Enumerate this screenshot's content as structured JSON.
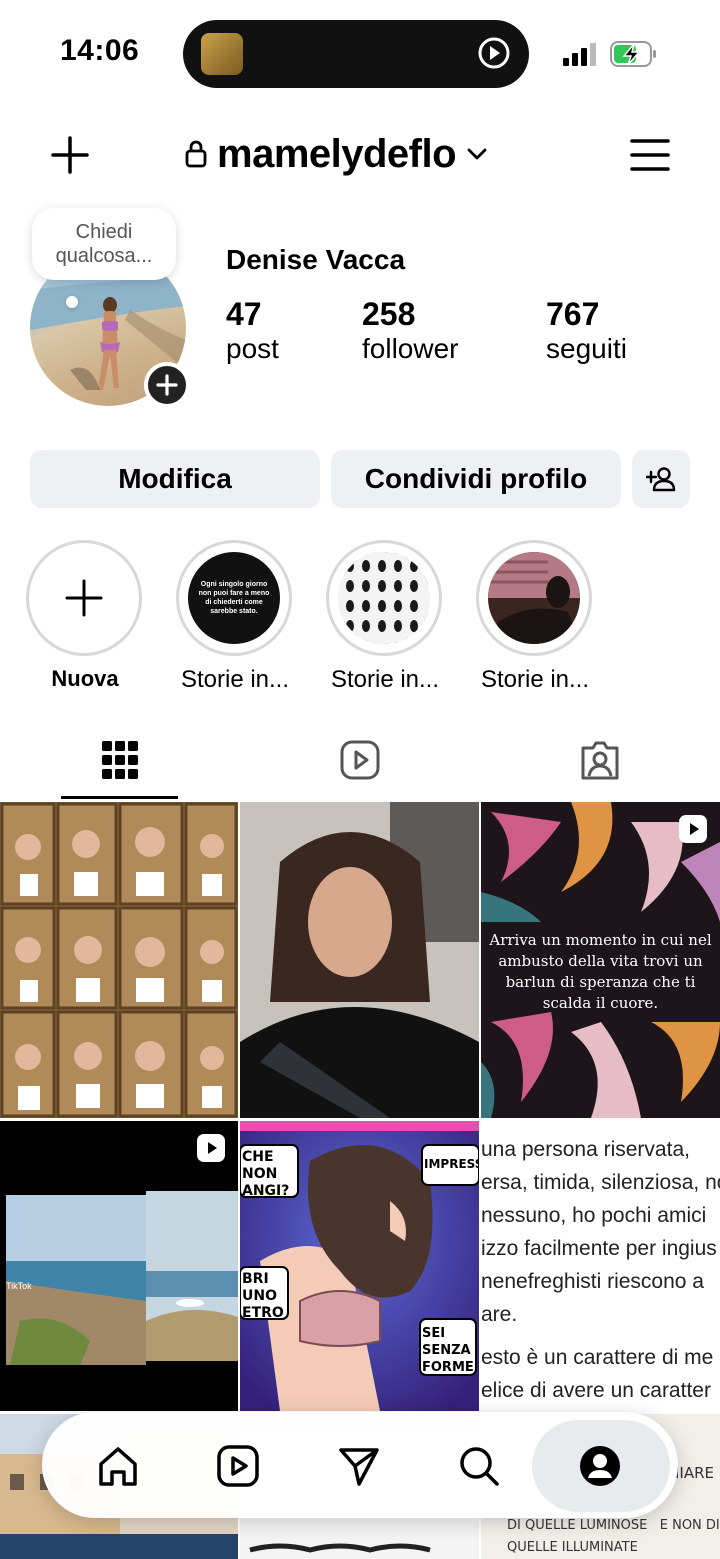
{
  "status_bar": {
    "time": "14:06",
    "battery_color": "#32c759"
  },
  "header": {
    "username": "mamelydeflo",
    "icons": [
      "plus-icon",
      "lock-icon",
      "chevron-down-icon",
      "menu-icon"
    ]
  },
  "profile": {
    "note": "Chiedi qualcosa...",
    "full_name": "Denise Vacca",
    "stats": [
      {
        "value": "47",
        "label": "post"
      },
      {
        "value": "258",
        "label": "follower"
      },
      {
        "value": "767",
        "label": "seguiti"
      }
    ]
  },
  "buttons": {
    "edit": "Modifica",
    "share": "Condividi profilo"
  },
  "highlights": [
    {
      "label": "Nuova"
    },
    {
      "label": "Storie in...",
      "text": "Ogni singolo giorno non puoi fare a meno di chiederti come sarebbe stato."
    },
    {
      "label": "Storie in..."
    },
    {
      "label": "Storie in..."
    }
  ],
  "tabs": [
    "grid-icon",
    "reels-icon",
    "tagged-icon"
  ],
  "posts": {
    "post3_text": "Arriva un momento in cui nel ambusto della vita trovi un barlun di speranza che ti scalda il cuore.",
    "post4_watermark": "TikTok",
    "post5_bubbles": [
      "CHE NON ANGI?",
      "IMPRESSIO",
      "BRI UNO ETRO",
      "SEI SENZA FORME"
    ],
    "post6_lines": [
      "una persona riservata,",
      "ersa, timida, silenziosa, no",
      "nessuno, ho pochi amici",
      "izzo facilmente per ingius",
      "nenefreghisti riescono a",
      "are.",
      "esto è un carattere di me",
      "elice di avere un caratter"
    ],
    "post9_lines": [
      "IIARE",
      "DI QUELLE LUMINOSE   E NON DI",
      "QUELLE ILLUMINATE"
    ]
  },
  "bottom_nav": [
    "home-icon",
    "reels-icon",
    "send-icon",
    "search-icon",
    "profile-icon"
  ]
}
